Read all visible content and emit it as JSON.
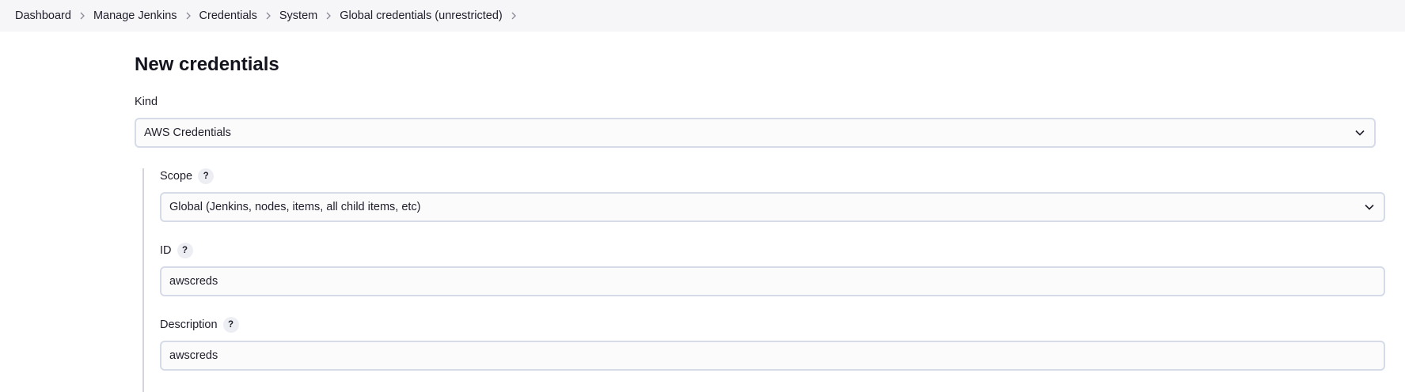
{
  "breadcrumb": {
    "items": [
      {
        "label": "Dashboard"
      },
      {
        "label": "Manage Jenkins"
      },
      {
        "label": "Credentials"
      },
      {
        "label": "System"
      },
      {
        "label": "Global credentials (unrestricted)"
      }
    ],
    "separator_icon": "chevron-right-icon"
  },
  "page": {
    "title": "New credentials"
  },
  "form": {
    "kind": {
      "label": "Kind",
      "selected": "AWS Credentials",
      "icon": "chevron-down-icon"
    },
    "scope": {
      "label": "Scope",
      "help": "?",
      "selected": "Global (Jenkins, nodes, items, all child items, etc)",
      "icon": "chevron-down-icon"
    },
    "id": {
      "label": "ID",
      "help": "?",
      "value": "awscreds"
    },
    "description": {
      "label": "Description",
      "help": "?",
      "value": "awscreds"
    }
  },
  "colors": {
    "breadcrumb_bg": "#f6f6f8",
    "input_border": "#d5dbe9",
    "input_bg": "#fbfbfc",
    "help_bg": "#eceef3",
    "nested_line": "#d4d4da"
  }
}
